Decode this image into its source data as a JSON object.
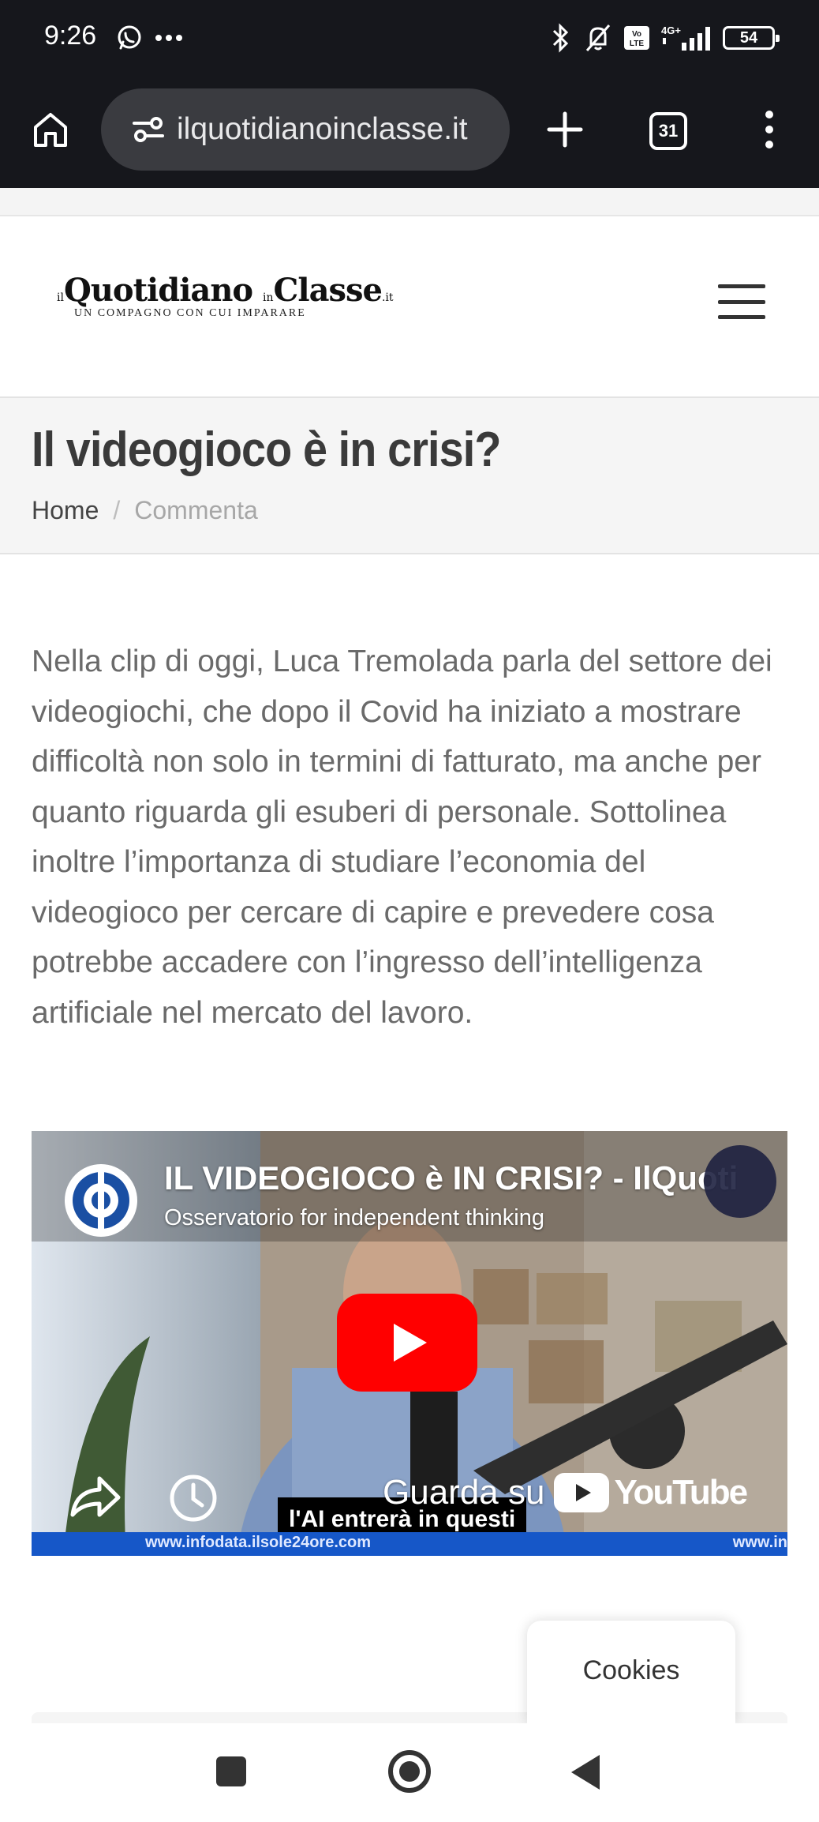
{
  "status_bar": {
    "time": "9:26",
    "battery": "54",
    "signal_text": "4G+",
    "volte_text": "Vo LTE"
  },
  "browser": {
    "url": "ilquotidianoinclasse.it",
    "tab_count": "31"
  },
  "site": {
    "logo_prefix_1": "il",
    "logo_word_1": "Quotidiano",
    "logo_prefix_2": "in",
    "logo_word_2": "Classe",
    "logo_suffix": ".it",
    "logo_tagline": "UN COMPAGNO CON CUI IMPARARE"
  },
  "page": {
    "title": "Il videogioco è in crisi?",
    "breadcrumb": {
      "home": "Home",
      "separator": "/",
      "current": "Commenta"
    },
    "article_text": "Nella clip di oggi, Luca Tremolada parla del settore dei videogiochi, che dopo il Covid ha iniziato a mostrare difficoltà non solo in termini di fatturato, ma anche per quanto riguarda gli esuberi di personale. Sottolinea inoltre l’importanza di studiare l’economia del videogioco per cercare di capire e prevedere cosa potrebbe accadere con l’ingresso dell’intelligenza artificiale nel mercato del lavoro."
  },
  "video": {
    "title": "IL VIDEOGIOCO è IN CRISI? - IlQuoti",
    "channel": "Osservatorio for independent thinking",
    "watch_on": "Guarda su",
    "youtube_wordmark": "YouTube",
    "caption": "l'AI entrerà in questi",
    "url_left": "www.infodata.ilsole24ore.com",
    "url_right": "www.in",
    "colors": {
      "play": "#ff0000",
      "url_bar": "#1657c8"
    }
  },
  "cookies": {
    "label": "Cookies"
  }
}
